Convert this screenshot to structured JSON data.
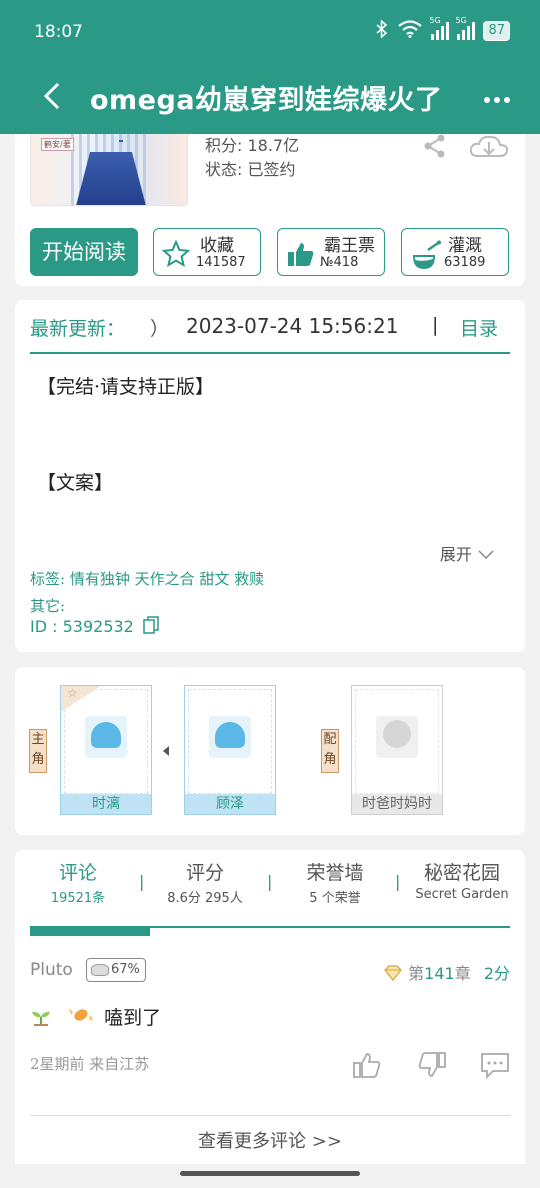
{
  "status_bar": {
    "time": "18:07",
    "signal1": "5G",
    "signal2": "5G",
    "battery": "87"
  },
  "nav": {
    "title": "omega幼崽穿到娃综爆火了"
  },
  "book": {
    "cover_tag_author": "鹤安/著",
    "score_line": "积分: 18.7亿",
    "status_line": "状态: 已签约"
  },
  "actions": {
    "read_label": "开始阅读",
    "collect": {
      "label": "收藏",
      "count": "141587"
    },
    "ticket": {
      "label": "霸王票",
      "count": "№418"
    },
    "nutrient": {
      "label": "灌溉",
      "count": "63189"
    }
  },
  "update": {
    "label": "最新更新：",
    "paren": "）",
    "datetime": "2023-07-24 15:56:21",
    "separator": "|",
    "toc": "目录",
    "desc_line1": "【完结·请支持正版】",
    "desc_line2": "【文案】",
    "expand": "展开",
    "tags": "标签: 情有独钟 天作之合 甜文 救赎",
    "other": "其它:",
    "id_line": "ID   : 5392532"
  },
  "characters": {
    "main_tag": "主角",
    "support_tag": "配角",
    "list": [
      {
        "name": "时漓"
      },
      {
        "name": "顾泽"
      },
      {
        "name": "时爸时妈时"
      }
    ]
  },
  "comments": {
    "tabs": [
      {
        "title": "评论",
        "sub": "19521条"
      },
      {
        "title": "评分",
        "sub": "8.6分 295人"
      },
      {
        "title": "荣誉墙",
        "sub": "5 个荣誉"
      },
      {
        "title": "秘密花园",
        "sub": "Secret Garden"
      }
    ],
    "tab_sep": "|",
    "item": {
      "user": "Pluto",
      "badge": "67%",
      "chapter_prefix": "第",
      "chapter_num": "141",
      "chapter_suffix": "章",
      "score": "2分",
      "body": "嗑到了",
      "meta": "2星期前 来自江苏"
    },
    "more": "查看更多评论 >>"
  },
  "colors": {
    "accent": "#2a9a86",
    "card": "#ffffff",
    "background": "#f2f2f2"
  }
}
